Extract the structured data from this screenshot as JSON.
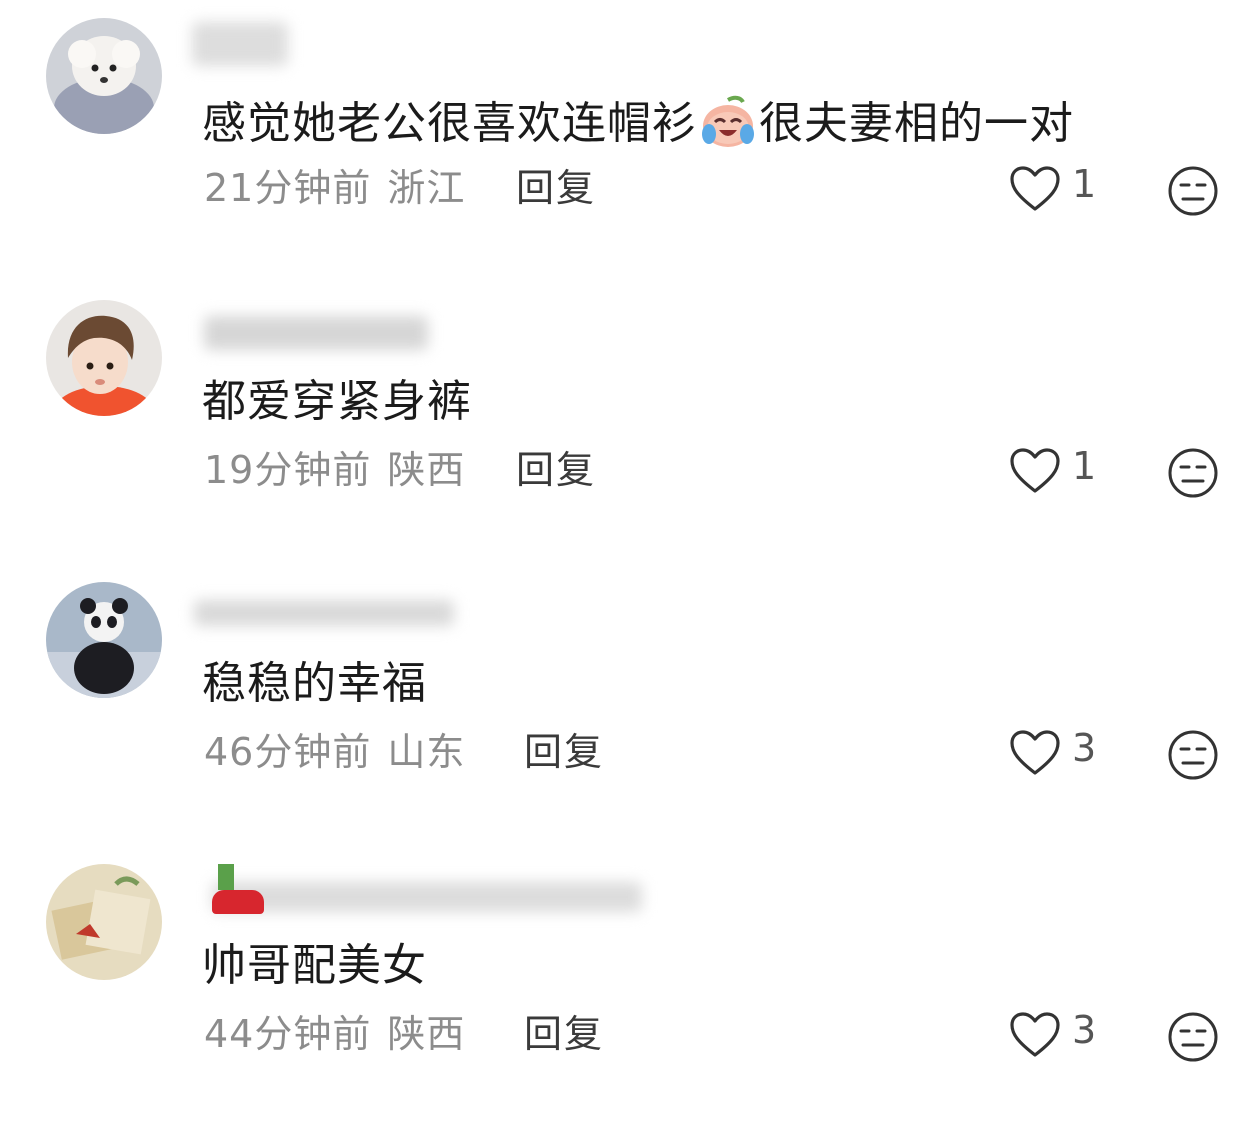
{
  "comments": [
    {
      "avatar": "white-dog-avatar",
      "text_before": "感觉她老公很喜欢连帽衫",
      "emoji": "crying-laughing-peach-emoji",
      "text_after": "很夫妻相的一对",
      "time": "21分钟前",
      "location": "浙江",
      "reply_label": "回复",
      "likes": "1"
    },
    {
      "avatar": "toddler-avatar",
      "text_before": "都爱穿紧身裤",
      "emoji": "",
      "text_after": "",
      "time": "19分钟前",
      "location": "陕西",
      "reply_label": "回复",
      "likes": "1"
    },
    {
      "avatar": "panda-costume-avatar",
      "text_before": "稳稳的幸福",
      "emoji": "",
      "text_after": "",
      "time": "46分钟前",
      "location": "山东",
      "reply_label": "回复",
      "likes": "3"
    },
    {
      "avatar": "paper-craft-avatar",
      "text_before": "帅哥配美女",
      "emoji": "",
      "text_after": "",
      "time": "44分钟前",
      "location": "陕西",
      "reply_label": "回复",
      "likes": "3"
    }
  ],
  "icons": {
    "like": "heart-outline-icon",
    "dislike": "neutral-face-icon"
  },
  "colors": {
    "text_primary": "#1b1b1b",
    "text_secondary": "#8c8c8c",
    "reply": "#3a3a3a",
    "icon": "#333333"
  }
}
